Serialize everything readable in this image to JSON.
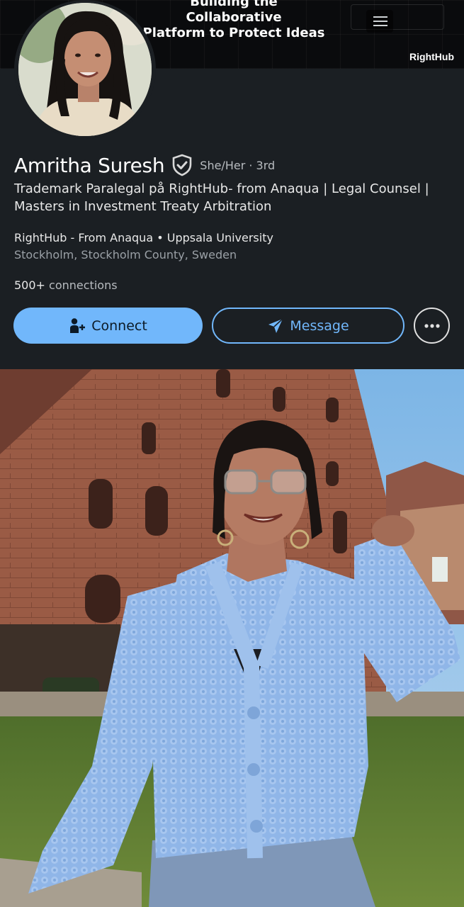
{
  "banner": {
    "title_line1": "Building the Collaborative",
    "title_line2": "Platform to Protect Ideas",
    "logo": "RightHub"
  },
  "profile": {
    "name": "Amritha Suresh",
    "verified_icon": "shield-check-icon",
    "pronouns_degree": "She/Her · 3rd",
    "headline": "Trademark Paralegal på RightHub- from Anaqua | Legal Counsel | Masters in Investment Treaty Arbitration",
    "company_school": "RightHub - From Anaqua • Uppsala University",
    "location": "Stockholm, Stockholm County, Sweden",
    "connections_count": "500+",
    "connections_label": "connections"
  },
  "actions": {
    "connect_label": "Connect",
    "message_label": "Message",
    "more_icon": "more-horizontal-icon"
  },
  "colors": {
    "background": "#1b1f23",
    "accent": "#71b7fb",
    "sweater": "#8fb4e6",
    "brick": "#9c5a45"
  }
}
